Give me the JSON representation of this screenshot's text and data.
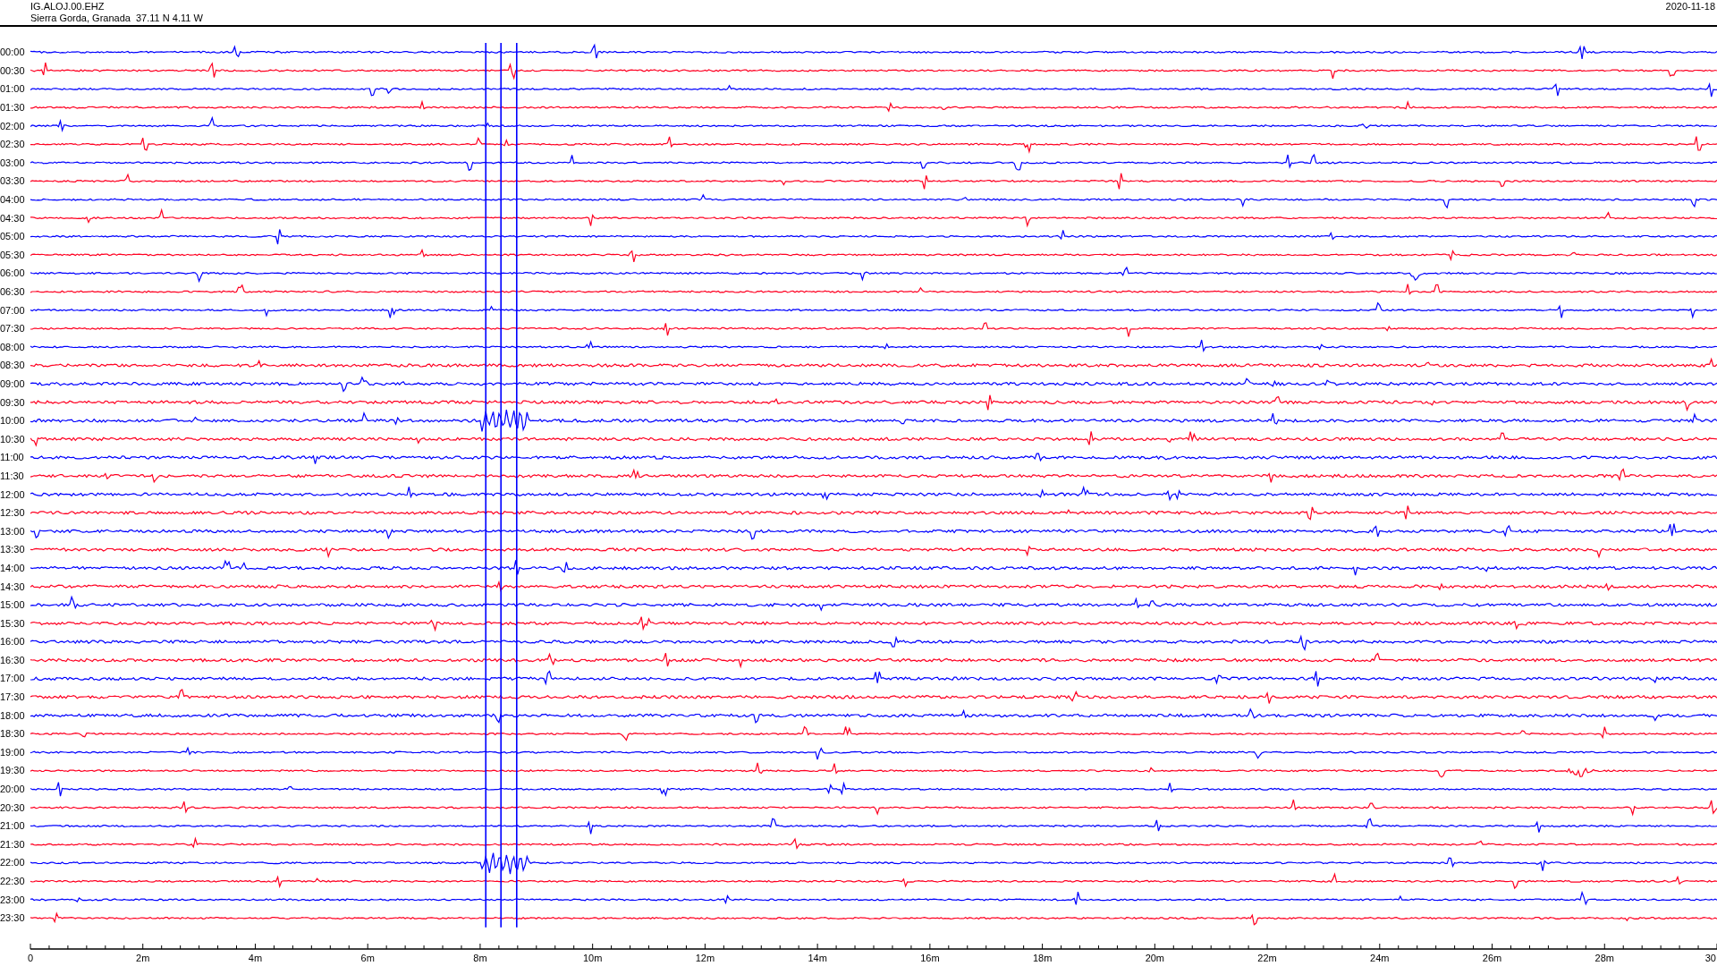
{
  "header": {
    "station": "IG.ALOJ.00.EHZ",
    "location": "Sierra Gorda, Granada  37.11 N 4.11 W",
    "date": "2020-11-18"
  },
  "traces": [
    {
      "time": "00:00",
      "color": "#0000ff"
    },
    {
      "time": "00:30",
      "color": "#ff0022"
    },
    {
      "time": "01:00",
      "color": "#0000ff"
    },
    {
      "time": "01:30",
      "color": "#ff0022"
    },
    {
      "time": "02:00",
      "color": "#0000ff"
    },
    {
      "time": "02:30",
      "color": "#ff0022"
    },
    {
      "time": "03:00",
      "color": "#0000ff"
    },
    {
      "time": "03:30",
      "color": "#ff0022"
    },
    {
      "time": "04:00",
      "color": "#0000ff"
    },
    {
      "time": "04:30",
      "color": "#ff0022"
    },
    {
      "time": "05:00",
      "color": "#0000ff"
    },
    {
      "time": "05:30",
      "color": "#ff0022"
    },
    {
      "time": "06:00",
      "color": "#0000ff"
    },
    {
      "time": "06:30",
      "color": "#ff0022"
    },
    {
      "time": "07:00",
      "color": "#0000ff"
    },
    {
      "time": "07:30",
      "color": "#ff0022"
    },
    {
      "time": "08:00",
      "color": "#0000ff"
    },
    {
      "time": "08:30",
      "color": "#ff0022"
    },
    {
      "time": "09:00",
      "color": "#0000ff"
    },
    {
      "time": "09:30",
      "color": "#ff0022"
    },
    {
      "time": "10:00",
      "color": "#0000ff"
    },
    {
      "time": "10:30",
      "color": "#ff0022"
    },
    {
      "time": "11:00",
      "color": "#0000ff"
    },
    {
      "time": "11:30",
      "color": "#ff0022"
    },
    {
      "time": "12:00",
      "color": "#0000ff"
    },
    {
      "time": "12:30",
      "color": "#ff0022"
    },
    {
      "time": "13:00",
      "color": "#0000ff"
    },
    {
      "time": "13:30",
      "color": "#ff0022"
    },
    {
      "time": "14:00",
      "color": "#0000ff"
    },
    {
      "time": "14:30",
      "color": "#ff0022"
    },
    {
      "time": "15:00",
      "color": "#0000ff"
    },
    {
      "time": "15:30",
      "color": "#ff0022"
    },
    {
      "time": "16:00",
      "color": "#0000ff"
    },
    {
      "time": "16:30",
      "color": "#ff0022"
    },
    {
      "time": "17:00",
      "color": "#0000ff"
    },
    {
      "time": "17:30",
      "color": "#ff0022"
    },
    {
      "time": "18:00",
      "color": "#0000ff"
    },
    {
      "time": "18:30",
      "color": "#ff0022"
    },
    {
      "time": "19:00",
      "color": "#0000ff"
    },
    {
      "time": "19:30",
      "color": "#ff0022"
    },
    {
      "time": "20:00",
      "color": "#0000ff"
    },
    {
      "time": "20:30",
      "color": "#ff0022"
    },
    {
      "time": "21:00",
      "color": "#0000ff"
    },
    {
      "time": "21:30",
      "color": "#ff0022"
    },
    {
      "time": "22:00",
      "color": "#0000ff"
    },
    {
      "time": "22:30",
      "color": "#ff0022"
    },
    {
      "time": "23:00",
      "color": "#0000ff"
    },
    {
      "time": "23:30",
      "color": "#ff0022"
    }
  ],
  "x_axis": {
    "ticks": [
      "0",
      "2m",
      "4m",
      "6m",
      "8m",
      "10m",
      "12m",
      "14m",
      "16m",
      "18m",
      "20m",
      "22m",
      "24m",
      "26m",
      "28m",
      "30"
    ]
  }
}
